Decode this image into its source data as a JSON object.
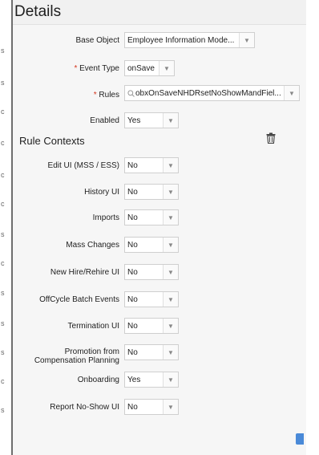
{
  "title": "Details",
  "base_object": {
    "label": "Base Object",
    "value": "Employee Information Mode..."
  },
  "event_type": {
    "required_mark": "*",
    "label": "Event Type",
    "value": "onSave"
  },
  "rules": {
    "required_mark": "*",
    "label": "Rules",
    "value": "obxOnSaveNHDRsetNoShowMandFiel..."
  },
  "enabled": {
    "label": "Enabled",
    "value": "Yes"
  },
  "rule_contexts": {
    "title": "Rule Contexts",
    "items": [
      {
        "label": "Edit UI (MSS / ESS)",
        "value": "No"
      },
      {
        "label": "History UI",
        "value": "No"
      },
      {
        "label": "Imports",
        "value": "No"
      },
      {
        "label": "Mass Changes",
        "value": "No"
      },
      {
        "label": "New Hire/Rehire UI",
        "value": "No"
      },
      {
        "label": "OffCycle Batch Events",
        "value": "No"
      },
      {
        "label": "Termination UI",
        "value": "No"
      },
      {
        "label_line1": "Promotion from",
        "label_line2": "Compensation Planning",
        "value": "No"
      },
      {
        "label": "Onboarding",
        "value": "Yes"
      },
      {
        "label": "Report No-Show UI",
        "value": "No"
      }
    ]
  },
  "left_strip_marks": [
    "s",
    "s",
    "c",
    "c",
    "c",
    "c",
    "s",
    "c",
    "s",
    "s",
    "s",
    "c",
    "s"
  ],
  "icons": {
    "dropdown": "chevron-down-icon",
    "delete": "trash-icon",
    "search": "search-icon"
  },
  "colors": {
    "required": "#d4351c",
    "accent": "#4a8ad8"
  }
}
